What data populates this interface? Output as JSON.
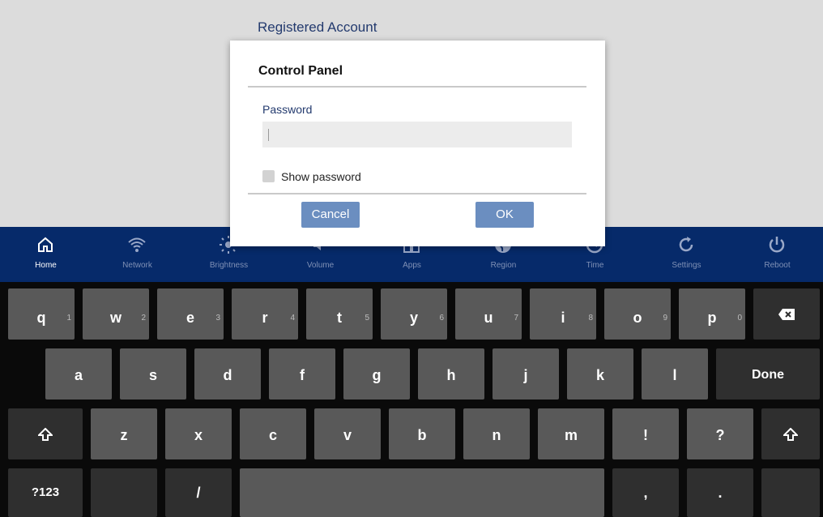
{
  "background": {
    "title": "Registered Account"
  },
  "navbar": {
    "items": [
      {
        "label": "Home",
        "icon": "home-icon",
        "active": true
      },
      {
        "label": "Network",
        "icon": "wifi-icon"
      },
      {
        "label": "Brightness",
        "icon": "brightness-icon"
      },
      {
        "label": "Volume",
        "icon": "volume-icon"
      },
      {
        "label": "Apps",
        "icon": "apps-icon"
      },
      {
        "label": "Region",
        "icon": "globe-icon"
      },
      {
        "label": "Time",
        "icon": "clock-icon"
      },
      {
        "label": "Settings",
        "icon": "refresh-icon"
      },
      {
        "label": "Reboot",
        "icon": "power-icon"
      }
    ]
  },
  "dialog": {
    "title": "Control Panel",
    "password_label": "Password",
    "password_value": "",
    "show_password_label": "Show password",
    "show_password_checked": false,
    "cancel_label": "Cancel",
    "ok_label": "OK"
  },
  "keyboard": {
    "row1": [
      {
        "label": "q",
        "hint": "1"
      },
      {
        "label": "w",
        "hint": "2"
      },
      {
        "label": "e",
        "hint": "3"
      },
      {
        "label": "r",
        "hint": "4"
      },
      {
        "label": "t",
        "hint": "5"
      },
      {
        "label": "y",
        "hint": "6"
      },
      {
        "label": "u",
        "hint": "7"
      },
      {
        "label": "i",
        "hint": "8"
      },
      {
        "label": "o",
        "hint": "9"
      },
      {
        "label": "p",
        "hint": "0"
      }
    ],
    "backspace_icon": "backspace-icon",
    "row2": [
      "a",
      "s",
      "d",
      "f",
      "g",
      "h",
      "j",
      "k",
      "l"
    ],
    "done_label": "Done",
    "shift_icon": "shift-icon",
    "row3": [
      "z",
      "x",
      "c",
      "v",
      "b",
      "n",
      "m",
      "!",
      "?"
    ],
    "symbols_label": "?123",
    "slash_label": "/",
    "comma_label": ",",
    "period_label": "."
  },
  "colors": {
    "navbar_bg": "#062a6a",
    "dialog_button": "#6b8ec0",
    "key": "#595959",
    "accent_text": "#233a6e"
  }
}
